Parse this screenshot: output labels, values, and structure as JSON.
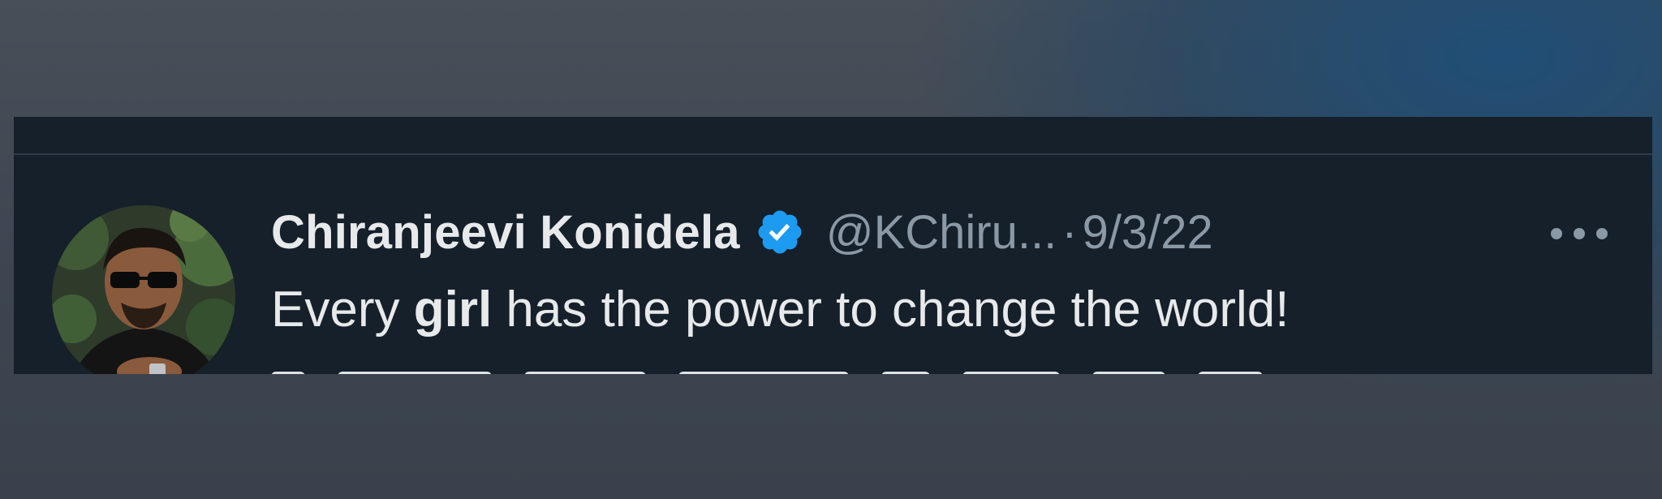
{
  "tweet": {
    "display_name": "Chiranjeevi Konidela",
    "handle": "@KChiru...",
    "separator": "·",
    "date": "9/3/22",
    "text_before": "Every ",
    "text_bold": "girl",
    "text_after": " has the power to change the world!"
  },
  "icons": {
    "verified": "verified-badge-icon",
    "more": "more-options-icon"
  },
  "colors": {
    "panel_background": "#15202b",
    "primary_text": "#e7e9ea",
    "secondary_text": "#8b98a5",
    "verified_blue": "#1d9bf0"
  }
}
